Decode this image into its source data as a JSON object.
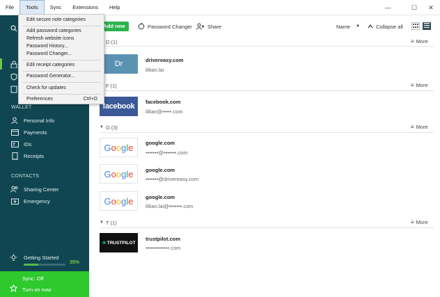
{
  "menubar": {
    "items": [
      "File",
      "Tools",
      "Sync",
      "Extensions",
      "Help"
    ]
  },
  "window_controls": {
    "minimize": "—",
    "maximize": "☐",
    "close": "✕"
  },
  "tools_menu": {
    "items": [
      "Edit secure note categories",
      "Add password categories",
      "Refresh website icons",
      "Password History...",
      "Password Changer...",
      "Edit receipt categories",
      "Password Generator...",
      "Check for updates",
      "Preferences"
    ],
    "preferences_shortcut": "Ctrl+O"
  },
  "sidebar": {
    "wallet_header": "WALLET",
    "wallet_items": [
      "Personal Info",
      "Payments",
      "IDs",
      "Receipts"
    ],
    "contacts_header": "CONTACTS",
    "contacts_items": [
      "Sharing Center",
      "Emergency"
    ],
    "getting_started": {
      "label": "Getting Started",
      "percent": "35%",
      "progress": 0.35
    },
    "sync": {
      "status": "Sync: Off",
      "action": "Turn on now"
    }
  },
  "toolbar": {
    "add_new": "Add new",
    "password_changer": "Password Changer",
    "share": "Share",
    "sort": "Name",
    "collapse_all": "Collapse all"
  },
  "groups": [
    {
      "label": "D (1)",
      "more": "More",
      "entries": [
        {
          "logo_text": "Dr",
          "title": "drivereasy.com",
          "login": "lillian.lai"
        }
      ]
    },
    {
      "label": "F (1)",
      "more": "More",
      "entries": [
        {
          "logo_text": "facebook",
          "title": "facebook.com",
          "login": "lillian@•••••.com"
        }
      ]
    },
    {
      "label": "G (3)",
      "more": "More",
      "entries": [
        {
          "logo_text": "Google",
          "title": "google.com",
          "login": "•••••••@•••••••.com"
        },
        {
          "logo_text": "Google",
          "title": "google.com",
          "login": "•••••••@drivereasy.com"
        },
        {
          "logo_text": "Google",
          "title": "google.com",
          "login": "lillian.lai@•••••••.com"
        }
      ]
    },
    {
      "label": "T (1)",
      "more": "More",
      "entries": [
        {
          "logo_text": "TRUSTPILOT",
          "title": "trustpilot.com",
          "login": "•••••••••••••.com"
        }
      ]
    }
  ],
  "colors": {
    "sidebar_bg": "#0f4651",
    "accent_green": "#2bb24c",
    "sync_green": "#2dc92d",
    "facebook_blue": "#3b5998"
  }
}
